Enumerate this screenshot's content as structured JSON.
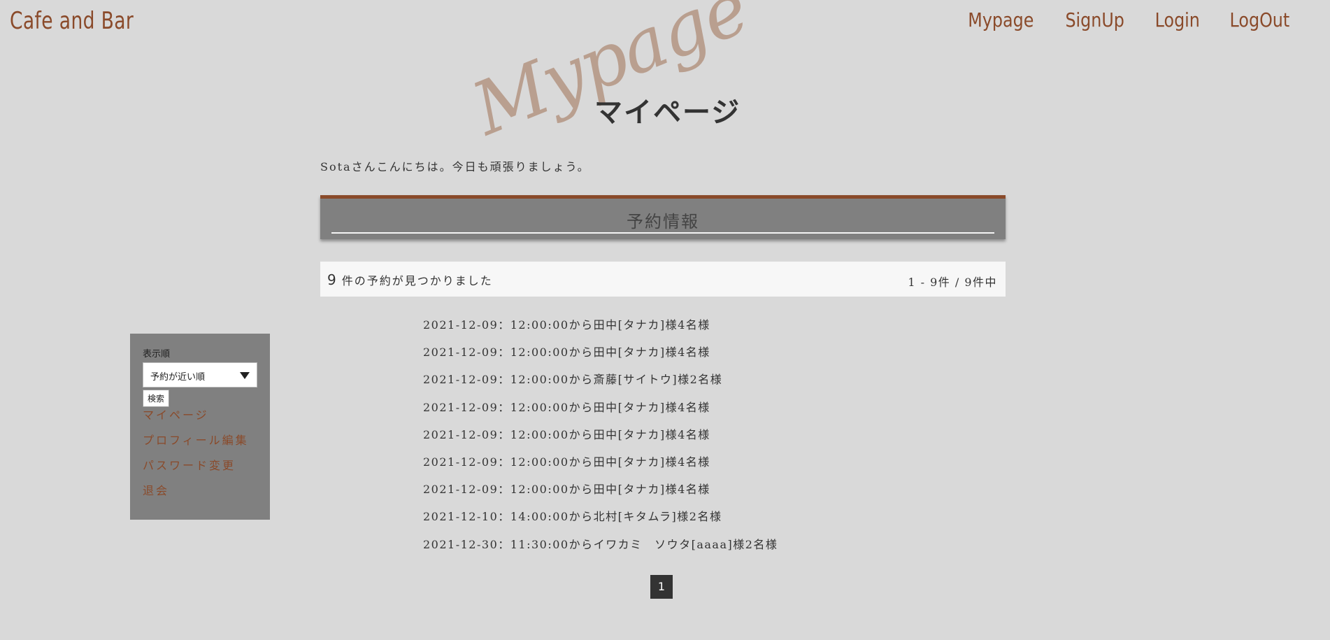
{
  "header": {
    "brand": "Cafe and Bar",
    "nav": [
      "Mypage",
      "SignUp",
      "Login",
      "LogOut"
    ]
  },
  "title": {
    "decoration": "Mypage",
    "heading": "マイページ"
  },
  "greeting": "Sotaさんこんにちは。今日も頑張りましょう。",
  "section": {
    "label": "予約情報"
  },
  "summary": {
    "count": "9",
    "found_text": "件の予約が見つかりました",
    "range_text": "1 - 9件 / 9件中"
  },
  "reservations": [
    "2021-12-09：12:00:00から田中[タナカ]様4名様",
    "2021-12-09：12:00:00から田中[タナカ]様4名様",
    "2021-12-09：12:00:00から斎藤[サイトウ]様2名様",
    "2021-12-09：12:00:00から田中[タナカ]様4名様",
    "2021-12-09：12:00:00から田中[タナカ]様4名様",
    "2021-12-09：12:00:00から田中[タナカ]様4名様",
    "2021-12-09：12:00:00から田中[タナカ]様4名様",
    "2021-12-10：14:00:00から北村[キタムラ]様2名様",
    "2021-12-30：11:30:00からイワカミ　ソウタ[aaaa]様2名様"
  ],
  "sidebar": {
    "sort_label": "表示順",
    "sort_selected": "予約が近い順",
    "search_button": "検索",
    "menu": [
      "マイページ",
      "プロフィール編集",
      "パスワード変更",
      "退会"
    ]
  },
  "pagination": {
    "current": "1"
  },
  "colors": {
    "background": "#d9d9d9",
    "accent": "#8a4a2a",
    "panel": "#808080",
    "decoration": "#b89c8c"
  }
}
